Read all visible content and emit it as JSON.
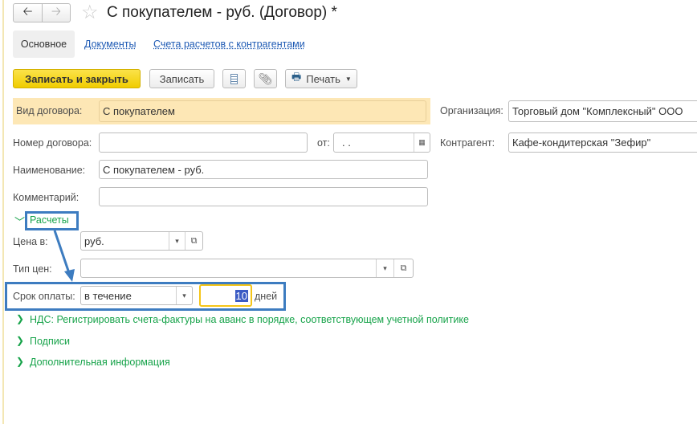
{
  "header": {
    "title": "С покупателем - руб. (Договор) *"
  },
  "tabs": [
    {
      "label": "Основное"
    },
    {
      "label": "Документы"
    },
    {
      "label": "Счета расчетов с контрагентами"
    }
  ],
  "toolbar": {
    "save_close": "Записать и закрыть",
    "save": "Записать",
    "print": "Печать"
  },
  "form": {
    "vid_label": "Вид договора:",
    "vid_value": "С покупателем",
    "org_label": "Организация:",
    "org_value": "Торговый дом \"Комплексный\" ООО",
    "num_label": "Номер договора:",
    "num_value": "",
    "date_label": "от:",
    "date_value": " .  .",
    "kontr_label": "Контрагент:",
    "kontr_value": "Кафе-кондитерская \"Зефир\"",
    "name_label": "Наименование:",
    "name_value": "С покупателем - руб.",
    "comment_label": "Комментарий:",
    "comment_value": ""
  },
  "payments": {
    "group_label": "Расчеты",
    "price_label": "Цена в:",
    "price_value": "руб.",
    "type_label": "Тип цен:",
    "type_value": "",
    "term_label": "Срок оплаты:",
    "term_value": "в течение",
    "term_days": "10",
    "days_label": "дней"
  },
  "groups": [
    {
      "label": "НДС: Регистрировать счета-фактуры на аванс в порядке, соответствующем учетной политике"
    },
    {
      "label": "Подписи"
    },
    {
      "label": "Дополнительная информация"
    }
  ],
  "colors": {
    "accent_yellow": "#f5d20a",
    "highlight": "#fde7b5",
    "link": "#1e5ab4",
    "group": "#17a34a",
    "annotation": "#3d7cc0"
  }
}
